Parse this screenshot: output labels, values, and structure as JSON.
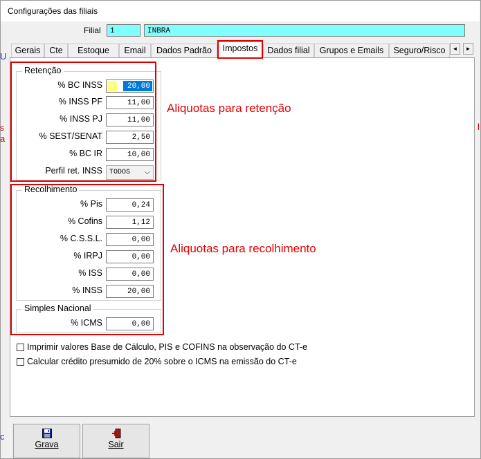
{
  "window": {
    "title": "Configurações das filiais"
  },
  "filial": {
    "label": "Filial",
    "code": "1",
    "name": "INBRA"
  },
  "tabs": [
    {
      "label": "Gerais"
    },
    {
      "label": "Cte"
    },
    {
      "label": "Estoque"
    },
    {
      "label": "Email"
    },
    {
      "label": "Dados Padrão"
    },
    {
      "label": "Impostos",
      "active": true
    },
    {
      "label": "Dados filial"
    },
    {
      "label": "Grupos e Emails"
    },
    {
      "label": "Seguro/Risco"
    }
  ],
  "tab_scroll": {
    "left": "◄",
    "right": "►"
  },
  "retencao": {
    "title": "Retenção",
    "rows": [
      {
        "label": "% BC INSS",
        "value": "20,00"
      },
      {
        "label": "% INSS PF",
        "value": "11,00"
      },
      {
        "label": "% INSS PJ",
        "value": "11,00"
      },
      {
        "label": "% SEST/SENAT",
        "value": "2,50"
      },
      {
        "label": "% BC IR",
        "value": "10,00"
      }
    ],
    "perfil": {
      "label": "Perfil ret. INSS",
      "value": "TODOS"
    }
  },
  "recolhimento": {
    "title": "Recolhimento",
    "rows": [
      {
        "label": "% Pis",
        "value": "0,24"
      },
      {
        "label": "% Cofins",
        "value": "1,12"
      },
      {
        "label": "% C.S.S.L.",
        "value": "0,00"
      },
      {
        "label": "% IRPJ",
        "value": "0,00"
      },
      {
        "label": "% ISS",
        "value": "0,00"
      },
      {
        "label": "% INSS",
        "value": "20,00"
      }
    ]
  },
  "simples": {
    "title": "Simples Nacional",
    "icms_label": "% ICMS",
    "icms_value": "0,00"
  },
  "annotations": {
    "retencao": "Aliquotas para retenção",
    "recolhimento": "Aliquotas para recolhimento"
  },
  "checkboxes": [
    {
      "label": "Imprimir valores Base de Cálculo, PIS e COFINS na observação do CT-e",
      "checked": false
    },
    {
      "label": "Calcular crédito presumido de 20% sobre o ICMS na emissão do CT-e",
      "checked": false
    }
  ],
  "buttons": {
    "grava": {
      "label": "Grava",
      "icon": "floppy-disk-icon"
    },
    "sair": {
      "label": "Sair",
      "icon": "exit-door-icon"
    }
  },
  "colors": {
    "highlight_red": "#e00000",
    "field_cyan": "#80ffff",
    "selection_blue": "#0078d7",
    "focus_yellow": "#ffff80"
  }
}
